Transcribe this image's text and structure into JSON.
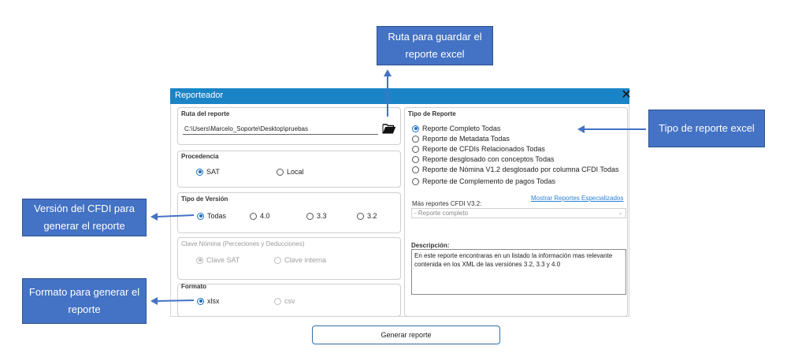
{
  "window": {
    "title": "Reporteador",
    "close_glyph": "✕"
  },
  "ruta": {
    "label": "Ruta del reporte",
    "value": "C:\\Users\\Marcelo_Soporte\\Desktop\\pruebas",
    "folder_icon": "folder-open-icon"
  },
  "procedencia": {
    "label": "Procedencia",
    "options": [
      {
        "label": "SAT",
        "selected": true
      },
      {
        "label": "Local",
        "selected": false
      }
    ]
  },
  "version": {
    "label": "Tipo de Versión",
    "options": [
      {
        "label": "Todas",
        "selected": true
      },
      {
        "label": "4.0",
        "selected": false
      },
      {
        "label": "3.3",
        "selected": false
      },
      {
        "label": "3.2",
        "selected": false
      }
    ]
  },
  "nomina": {
    "label": "Clave Nómina (Perceciones y Deducciones)",
    "options": [
      {
        "label": "Clave SAT",
        "selected": true
      },
      {
        "label": "Clave interna",
        "selected": false
      }
    ]
  },
  "formato": {
    "label": "Formato",
    "options": [
      {
        "label": "xlsx",
        "selected": true
      },
      {
        "label": "csv",
        "selected": false
      }
    ]
  },
  "tipo_reporte": {
    "label": "Tipo de Reporte",
    "options": [
      {
        "label": "Reporte Completo Todas",
        "selected": true
      },
      {
        "label": "Reporte de Metadata Todas",
        "selected": false
      },
      {
        "label": "Reporte de CFDIs Relacionados Todas",
        "selected": false
      },
      {
        "label": "Reporte desglosado con conceptos Todas",
        "selected": false
      },
      {
        "label": "Reporte de Nómina V1.2 desglosado por columna CFDI Todas",
        "selected": false
      },
      {
        "label": "Reporte de Complemento de pagos Todas",
        "selected": false
      }
    ],
    "link": "Mostrar Reportes Especializados",
    "mas_label": "Más reportes CFDI V3.2:",
    "mas_value": "- Reporte completo"
  },
  "descripcion": {
    "label": "Descripción:",
    "text": "En este reporte encontraras en un listado la información mas relevante contenida en los XML de las  versiónes 3.2, 3.3 y 4.0"
  },
  "generar_button": "Generar reporte",
  "callouts": {
    "ruta": "Ruta para guardar el reporte excel",
    "tipo": "Tipo de reporte excel",
    "version": "Versión del CFDI para generar el reporte",
    "formato": "Formato para generar el reporte"
  },
  "colors": {
    "titlebar": "#1b84c7",
    "callout": "#4472c4",
    "radio_selected": "#1a6fc0",
    "link": "#2a7fd4"
  }
}
